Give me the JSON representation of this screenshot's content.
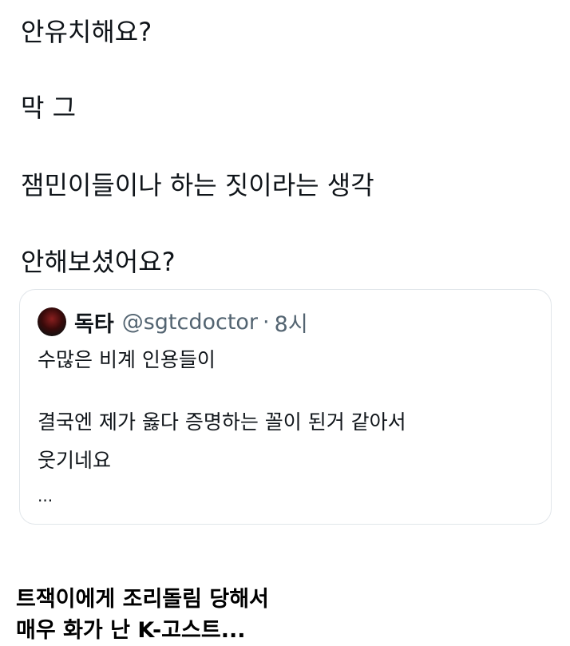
{
  "reply": {
    "lines": [
      "안유치해요?",
      "막 그",
      "잼민이들이나 하는 짓이라는 생각",
      "안해보셨어요?"
    ]
  },
  "quoted_tweet": {
    "author_name": "독타",
    "author_handle": "@sgtcdoctor",
    "separator": "·",
    "time": "8시",
    "body_lines": [
      "수많은 비계 인용들이",
      "결국엔 제가 옳다 증명하는 꼴이 된거 같아서",
      "웃기네요",
      "..."
    ]
  },
  "caption": {
    "lines": [
      "트잭이에게 조리돌림 당해서",
      "매우 화가 난 K-고스트..."
    ]
  },
  "colors": {
    "text_primary": "#0f1419",
    "text_secondary": "#536471",
    "card_border": "#e1e6ea",
    "background": "#ffffff"
  }
}
